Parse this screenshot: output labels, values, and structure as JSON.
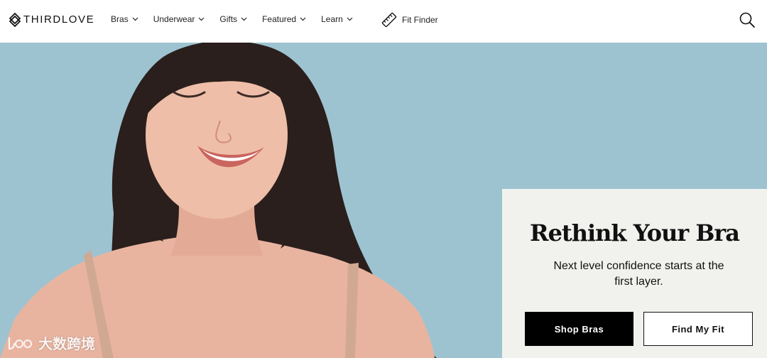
{
  "header": {
    "logo_text": "THIRDLOVE",
    "nav": [
      {
        "label": "Bras"
      },
      {
        "label": "Underwear"
      },
      {
        "label": "Gifts"
      },
      {
        "label": "Featured"
      },
      {
        "label": "Learn"
      }
    ],
    "fit_finder_label": "Fit Finder",
    "icons": {
      "logo": "thirdlove-diamond-logo",
      "dropdown": "chevron-down-icon",
      "fit_finder": "ruler-icon",
      "search": "search-icon"
    }
  },
  "hero": {
    "background_color": "#9dc3d1",
    "image": "smiling-woman-in-bra-photo"
  },
  "promo": {
    "title": "Rethink Your Bra",
    "subtitle": "Next level confidence starts at the first layer.",
    "primary_button": "Shop Bras",
    "secondary_button": "Find My Fit"
  },
  "watermark": {
    "text": "大数跨境"
  }
}
